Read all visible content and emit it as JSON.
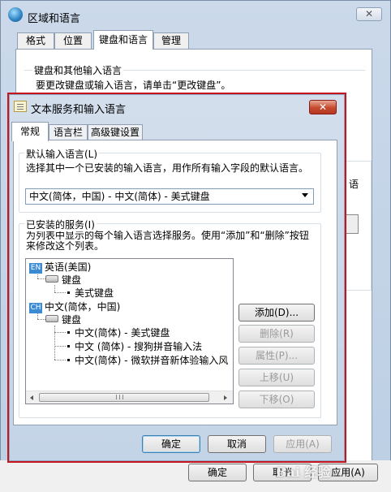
{
  "background_window": {
    "title": "区域和语言",
    "close_label": "✕",
    "tabs": [
      {
        "label": "格式"
      },
      {
        "label": "位置"
      },
      {
        "label": "键盘和语言"
      },
      {
        "label": "管理"
      }
    ],
    "group_title": "键盘和其他输入语言",
    "description": "要更改键盘或输入语言，请单击“更改键盘”。",
    "side_text": "语",
    "buttons": {
      "ok": "确定",
      "cancel": "取消",
      "apply": "应用(A)"
    }
  },
  "dialog": {
    "title": "文本服务和输入语言",
    "close_label": "✕",
    "tabs": [
      {
        "label": "常规"
      },
      {
        "label": "语言栏"
      },
      {
        "label": "高级键设置"
      }
    ],
    "default_language": {
      "title": "默认输入语言(L)",
      "description": "选择其中一个已安装的输入语言，用作所有输入字段的默认语言。",
      "selected": "中文(简体，中国) - 中文(简体) - 美式键盘"
    },
    "installed_services": {
      "title": "已安装的服务(I)",
      "description": "为列表中显示的每个输入语言选择服务。使用“添加”和“删除”按钮来修改这个列表。",
      "tree": {
        "lang1_badge": "EN",
        "lang1": "英语(美国)",
        "lang1_keyboard": "键盘",
        "lang1_item1": "美式键盘",
        "lang2_badge": "CH",
        "lang2": "中文(简体，中国)",
        "lang2_keyboard": "键盘",
        "lang2_item1": "中文(简体) - 美式键盘",
        "lang2_item2": "中文 (简体) - 搜狗拼音输入法",
        "lang2_item3": "中文(简体) - 微软拼音新体验输入风"
      },
      "buttons": {
        "add": "添加(D)...",
        "remove": "删除(R)",
        "properties": "属性(P)...",
        "move_up": "上移(U)",
        "move_down": "下移(O)"
      }
    },
    "footer": {
      "ok": "确定",
      "cancel": "取消",
      "apply": "应用(A)"
    }
  },
  "watermark": "Bai 经验"
}
